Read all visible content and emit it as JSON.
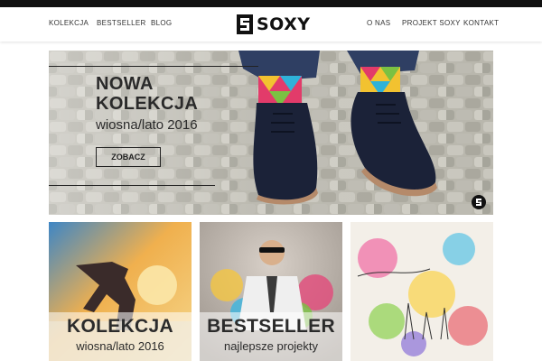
{
  "header": {
    "nav_left": [
      "KOLEKCJA",
      "BESTSELLER",
      "BLOG"
    ],
    "nav_right": [
      "O NAS",
      "PROJEKT SOXY",
      "KONTAKT"
    ],
    "logo_text": "SOXY"
  },
  "hero": {
    "title": "NOWA KOLEKCJA",
    "subtitle": "wiosna/lato 2016",
    "button": "ZOBACZ"
  },
  "tiles": [
    {
      "title": "KOLEKCJA",
      "subtitle": "wiosna/lato 2016"
    },
    {
      "title": "BESTSELLER",
      "subtitle": "najlepsze projekty"
    },
    {
      "title": "",
      "subtitle": ""
    }
  ],
  "colors": {
    "topbar": "#111111",
    "text": "#2a2a2a",
    "accent_orange": "#f39a3a"
  }
}
